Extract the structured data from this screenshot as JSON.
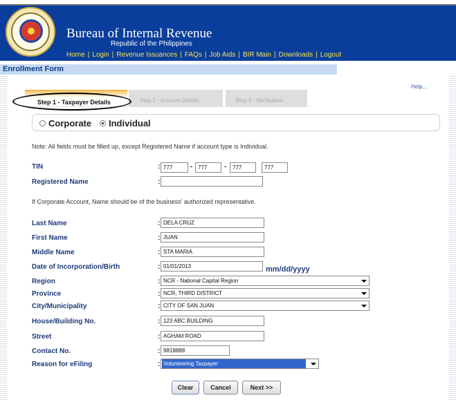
{
  "header": {
    "title": "Bureau of Internal Revenue",
    "subtitle": "Republic of the Philippines",
    "brand_color": "#0a3e9c",
    "nav": [
      "Home",
      "Login",
      "Revenue Issuances",
      "FAQs",
      "Job Aids",
      "BIR Main",
      "Downloads",
      "Logout"
    ]
  },
  "form": {
    "title": "Enrollment Form",
    "help": "Help...",
    "tabs": [
      "Step 1 - Taxpayer Details",
      "Step 2 - Account Details",
      "Step 3 - Verification"
    ],
    "account_type": {
      "corporate": "Corporate",
      "individual": "Individual",
      "selected": "Individual"
    },
    "note1": "Note: All fields must be filled up, except Registered Name if account type is Individual.",
    "note2": "If Corporate Account, Name should be of the business' authorized representative.",
    "labels": {
      "tin": "TIN",
      "registered_name": "Registered Name",
      "last_name": "Last Name",
      "first_name": "First Name",
      "middle_name": "Middle Name",
      "dob": "Date of Incorporation/Birth",
      "region": "Region",
      "province": "Province",
      "city": "City/Municipality",
      "house": "House/Building No.",
      "street": "Street",
      "contact": "Contact No.",
      "reason": "Reason for eFiling"
    },
    "colon": ":",
    "dash": "-",
    "values": {
      "tin": [
        "777",
        "777",
        "777",
        "777"
      ],
      "registered_name": "",
      "last_name": "DELA CRUZ",
      "first_name": "JUAN",
      "middle_name": "STA MARIA",
      "dob": "01/01/2013",
      "region": "NCR - National Capital Region",
      "province": "NCR, THIRD DISTRICT",
      "city": "CITY OF SAN JUAN",
      "house": "123 ABC BUILDING",
      "street": "AGHAM ROAD",
      "contact": "9818888",
      "reason": "Volunteering Taxpayer"
    },
    "date_format": "mm/dd/yyyy",
    "buttons": {
      "clear": "Clear",
      "cancel": "Cancel",
      "next": "Next >>"
    }
  }
}
